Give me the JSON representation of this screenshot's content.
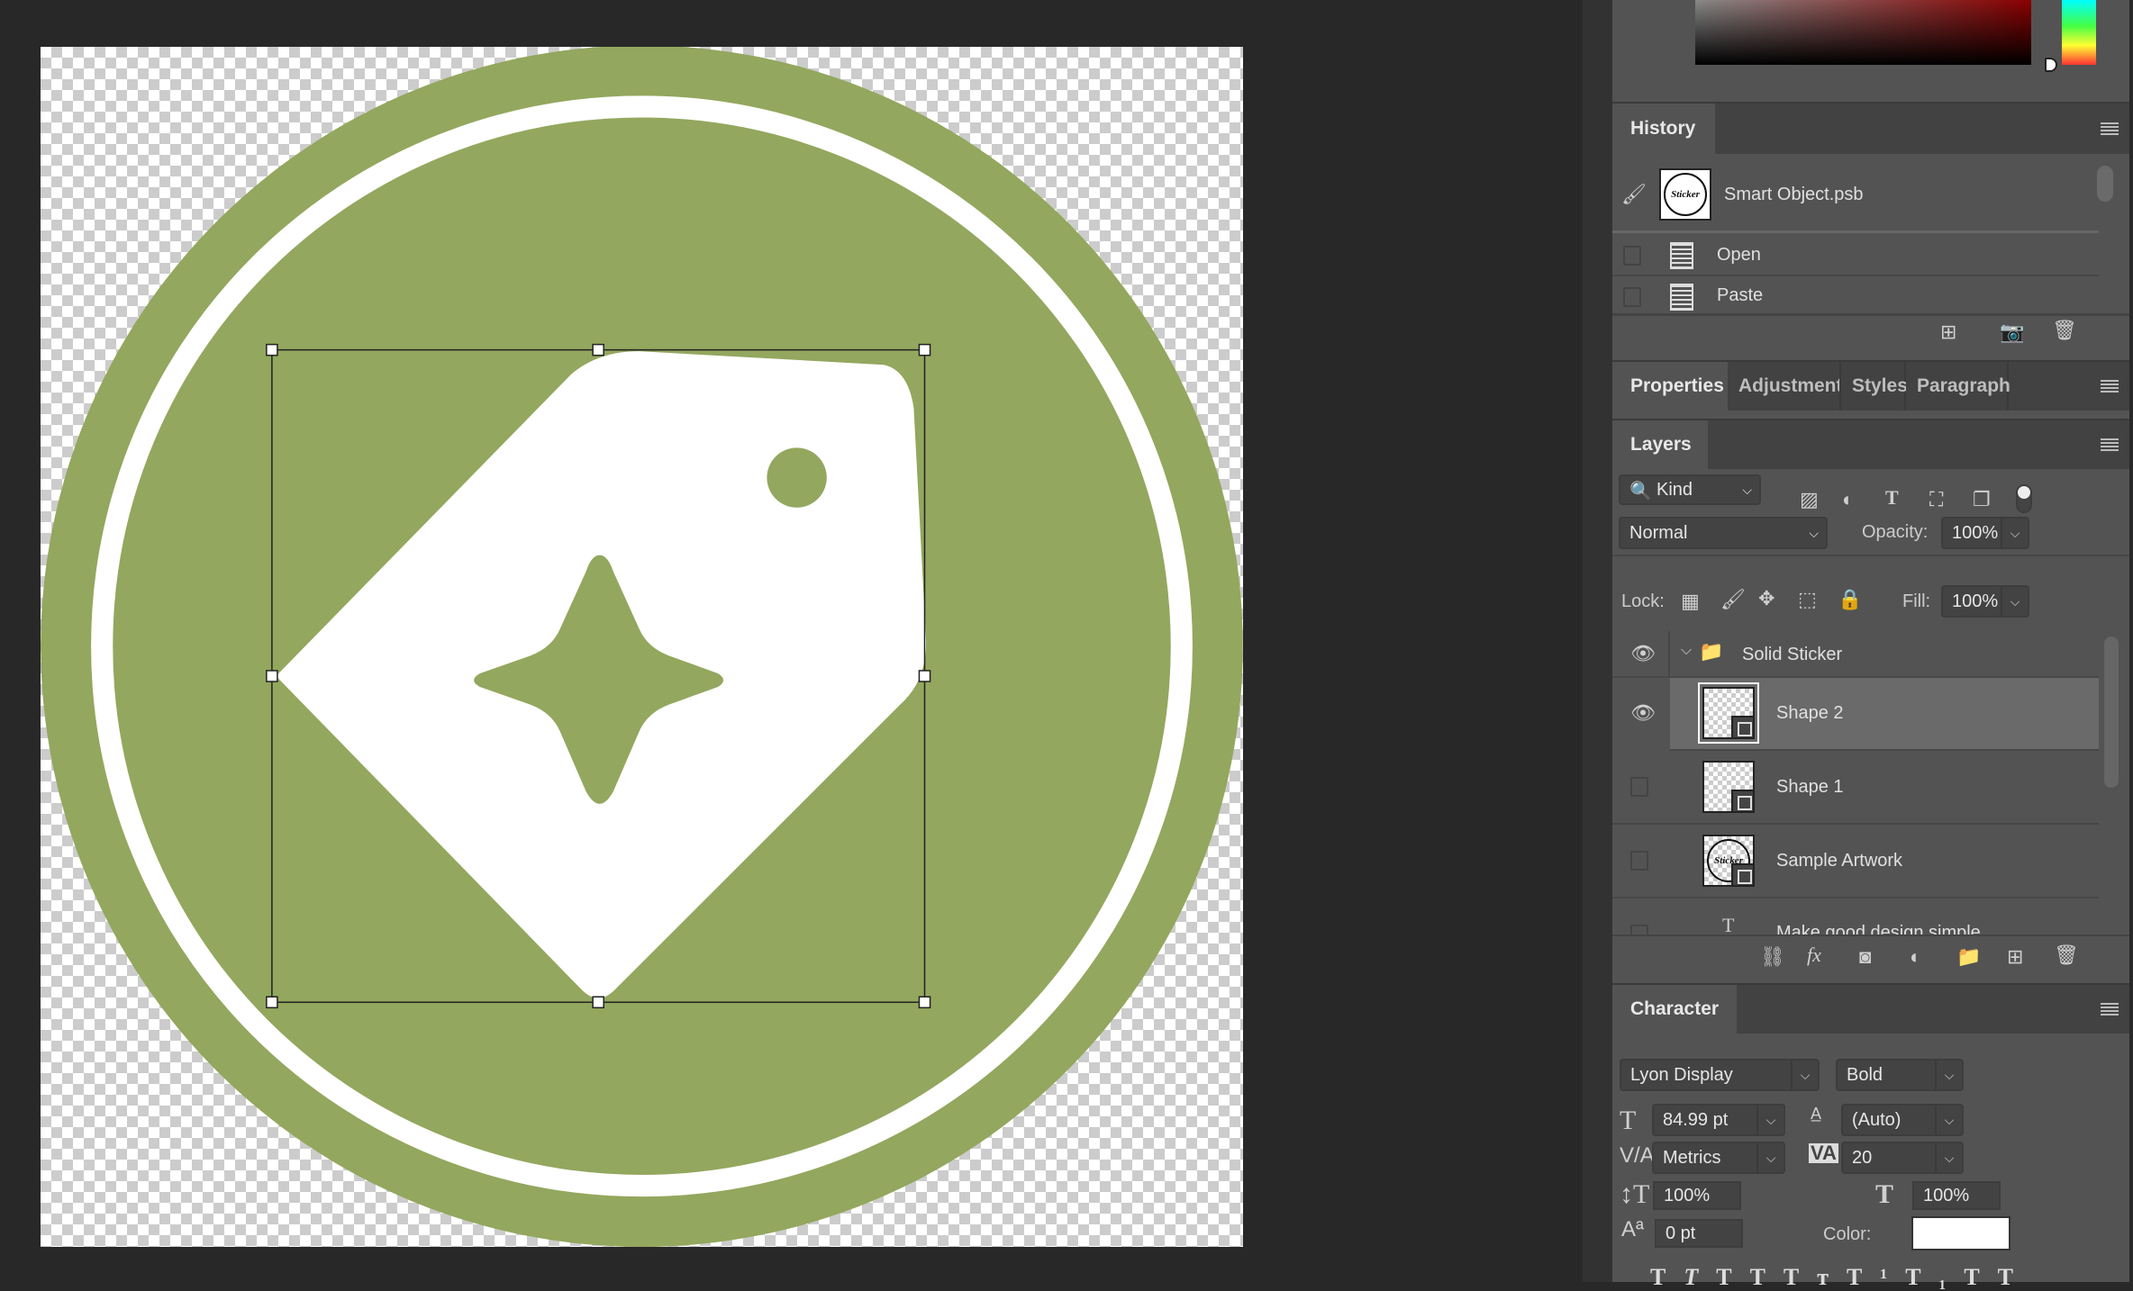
{
  "canvas": {
    "sticker_color": "#93a75e",
    "ring_color": "#ffffff",
    "tag_color": "#ffffff"
  },
  "history": {
    "tab": "History",
    "items": [
      {
        "label": "Smart Object.psb",
        "thumb_text": "Sticker"
      },
      {
        "label": "Open"
      },
      {
        "label": "Paste"
      }
    ],
    "footer_icons": [
      "new-document-from-state-icon",
      "snapshot-camera-icon",
      "trash-icon"
    ]
  },
  "properties_tabs": [
    "Properties",
    "Adjustments",
    "Styles",
    "Paragraph"
  ],
  "layers": {
    "tab": "Layers",
    "filter": "Kind",
    "blend_mode": "Normal",
    "opacity_label": "Opacity:",
    "opacity": "100%",
    "lock_label": "Lock:",
    "fill_label": "Fill:",
    "fill": "100%",
    "items": [
      {
        "name": "Solid Sticker",
        "type": "group",
        "visible": true
      },
      {
        "name": "Shape 2",
        "type": "shape",
        "visible": true,
        "selected": true
      },
      {
        "name": "Shape 1",
        "type": "shape",
        "visible": false
      },
      {
        "name": "Sample Artwork",
        "type": "smart-object",
        "visible": false
      },
      {
        "name": "Make good design simple",
        "type": "text",
        "visible": false
      }
    ]
  },
  "character": {
    "tab": "Character",
    "font_family": "Lyon Display",
    "font_style": "Bold",
    "size": "84.99 pt",
    "leading": "(Auto)",
    "kerning": "Metrics",
    "tracking": "20",
    "vscale": "100%",
    "hscale": "100%",
    "baseline": "0 pt",
    "color_label": "Color:",
    "color": "#ffffff"
  }
}
